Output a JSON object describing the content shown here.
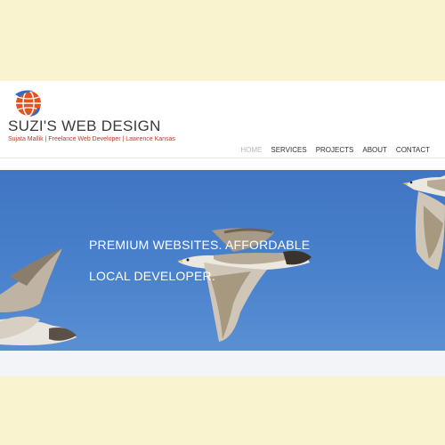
{
  "site": {
    "title": "SUZI'S WEB DESIGN",
    "tagline": "Sujata Mallik | Freelance Web Developer | Lawrence Kansas"
  },
  "nav": {
    "items": [
      "HOME",
      "SERVICES",
      "PROJECTS",
      "ABOUT",
      "CONTACT"
    ],
    "active": "HOME"
  },
  "hero": {
    "line1": "PREMIUM WEBSITES. AFFORDABLE",
    "line2": "LOCAL DEVELOPER."
  },
  "colors": {
    "page_background": "#f9f3cf",
    "tagline": "#c0392b",
    "hero_sky": "#4a81cc",
    "nav_active": "#b8b8b8"
  },
  "icons": [
    "globe-logo-icon"
  ]
}
